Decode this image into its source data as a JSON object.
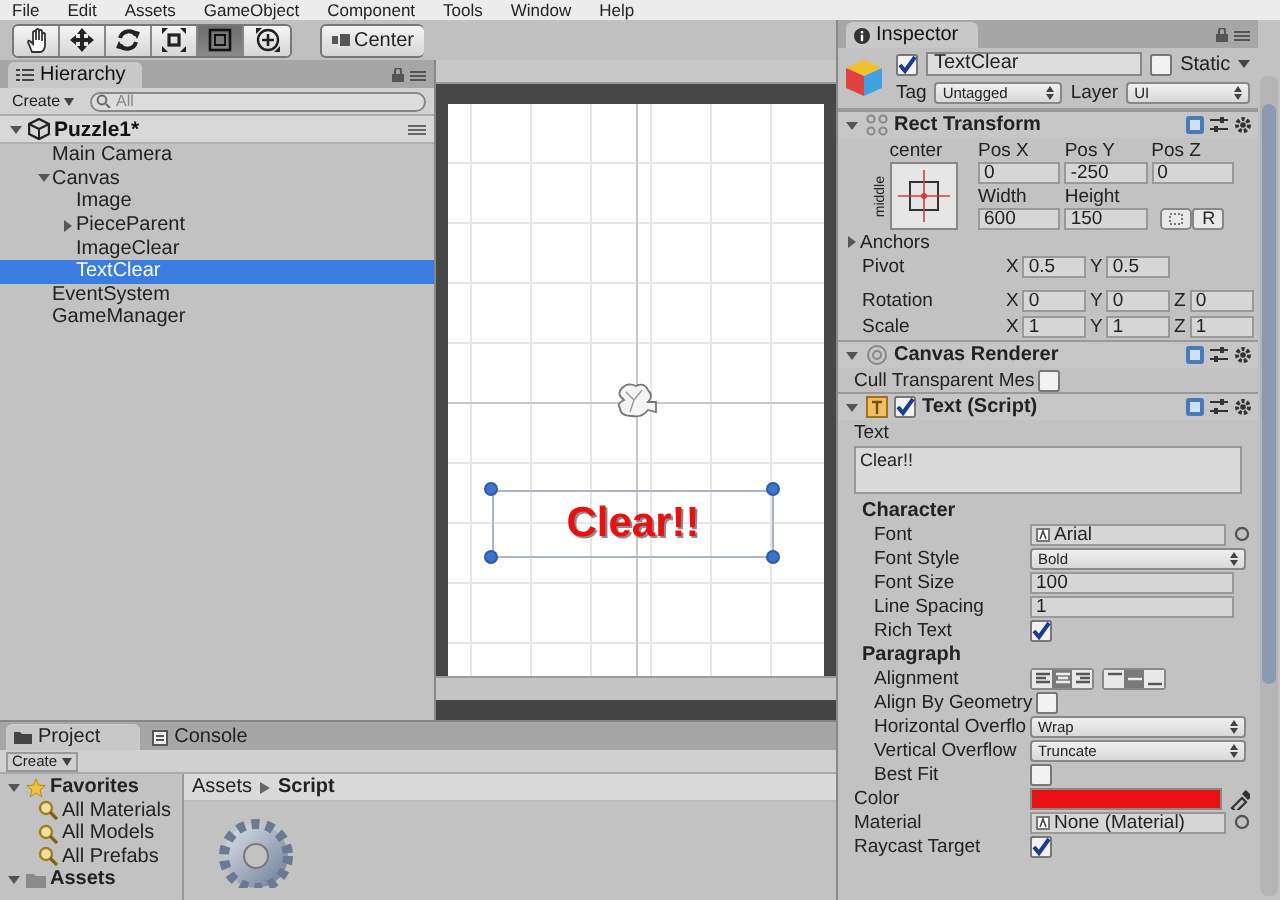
{
  "menu": [
    "File",
    "Edit",
    "Assets",
    "GameObject",
    "Component",
    "Tools",
    "Window",
    "Help"
  ],
  "toolbar": {
    "tools": [
      {
        "kind": "hand",
        "selected": false
      },
      {
        "kind": "move",
        "selected": false
      },
      {
        "kind": "rotate",
        "selected": false
      },
      {
        "kind": "scale",
        "selected": false
      },
      {
        "kind": "rect",
        "selected": true
      },
      {
        "kind": "transform",
        "selected": false
      }
    ],
    "pivot_button": "Center"
  },
  "hierarchy": {
    "tab": "Hierarchy",
    "create": "Create",
    "search_placeholder": "All",
    "scene": "Puzzle1*",
    "items": [
      {
        "label": "Main Camera",
        "selected": false
      },
      {
        "label": "Canvas",
        "selected": false,
        "expanded": true,
        "children": [
          {
            "label": "Image",
            "selected": false
          },
          {
            "label": "PieceParent",
            "selected": false,
            "expanded": false
          },
          {
            "label": "ImageClear",
            "selected": false
          },
          {
            "label": "TextClear",
            "selected": true
          }
        ]
      },
      {
        "label": "EventSystem",
        "selected": false
      },
      {
        "label": "GameManager",
        "selected": false
      }
    ]
  },
  "scene": {
    "text": "Clear!!"
  },
  "inspector": {
    "tab": "Inspector",
    "object": {
      "active": true,
      "name": "TextClear",
      "static_label": "Static",
      "static": false,
      "tag_label": "Tag",
      "tag": "Untagged",
      "layer_label": "Layer",
      "layer": "UI"
    },
    "components": [
      {
        "kind": "rect_transform",
        "title": "Rect Transform",
        "expanded": true,
        "anchor_h": "center",
        "anchor_v": "middle",
        "columns": [
          "Pos X",
          "Pos Y",
          "Pos Z"
        ],
        "values": [
          "0",
          "-250",
          "0"
        ],
        "size_labels": [
          "Width",
          "Height"
        ],
        "size_values": [
          "600",
          "150"
        ],
        "reset_button": "R",
        "anchors": {
          "label": "Anchors",
          "expanded": false
        },
        "rows": [
          {
            "label": "Pivot",
            "axes": [
              {
                "axis": "X",
                "value": "0.5"
              },
              {
                "axis": "Y",
                "value": "0.5"
              }
            ]
          },
          {
            "label": "Rotation",
            "axes": [
              {
                "axis": "X",
                "value": "0"
              },
              {
                "axis": "Y",
                "value": "0"
              },
              {
                "axis": "Z",
                "value": "0"
              }
            ]
          },
          {
            "label": "Scale",
            "axes": [
              {
                "axis": "X",
                "value": "1"
              },
              {
                "axis": "Y",
                "value": "1"
              },
              {
                "axis": "Z",
                "value": "1"
              }
            ]
          }
        ]
      },
      {
        "kind": "canvas_renderer",
        "title": "Canvas Renderer",
        "expanded": true,
        "properties": [
          {
            "kind": "checkbox",
            "label": "Cull Transparent Mes",
            "checked": false
          }
        ]
      },
      {
        "kind": "text_script",
        "title": "Text (Script)",
        "expanded": true,
        "enabled": true,
        "text_label": "Text",
        "text_value": "Clear!!",
        "sections": [
          {
            "title": "Character",
            "properties": [
              {
                "kind": "object",
                "label": "Font",
                "value": "Arial"
              },
              {
                "kind": "dropdown",
                "label": "Font Style",
                "value": "Bold"
              },
              {
                "kind": "field",
                "label": "Font Size",
                "value": "100"
              },
              {
                "kind": "field",
                "label": "Line Spacing",
                "value": "1"
              },
              {
                "kind": "checkbox",
                "label": "Rich Text",
                "checked": true
              }
            ]
          },
          {
            "title": "Paragraph",
            "properties": [
              {
                "kind": "alignment",
                "label": "Alignment",
                "horizontal": [
                  {
                    "selected": false
                  },
                  {
                    "selected": true
                  },
                  {
                    "selected": false
                  }
                ],
                "vertical": [
                  {
                    "selected": false
                  },
                  {
                    "selected": true
                  },
                  {
                    "selected": false
                  }
                ]
              },
              {
                "kind": "checkbox",
                "label": "Align By Geometry",
                "checked": false
              },
              {
                "kind": "dropdown",
                "label": "Horizontal Overflo",
                "value": "Wrap"
              },
              {
                "kind": "dropdown",
                "label": "Vertical Overflow",
                "value": "Truncate"
              },
              {
                "kind": "checkbox",
                "label": "Best Fit",
                "checked": false
              }
            ]
          }
        ],
        "properties": [
          {
            "kind": "color",
            "label": "Color",
            "color": "#e81010"
          },
          {
            "kind": "object",
            "label": "Material",
            "value": "None (Material)"
          },
          {
            "kind": "checkbox",
            "label": "Raycast Target",
            "checked": true
          }
        ]
      }
    ]
  },
  "project": {
    "tabs": [
      {
        "label": "Project",
        "selected": true
      },
      {
        "label": "Console",
        "selected": false
      }
    ],
    "create": "Create",
    "favorites": {
      "label": "Favorites",
      "expanded": true,
      "items": [
        "All Materials",
        "All Models",
        "All Prefabs"
      ]
    },
    "assets": {
      "label": "Assets",
      "expanded": true
    },
    "breadcrumb": [
      "Assets",
      "Script"
    ]
  }
}
